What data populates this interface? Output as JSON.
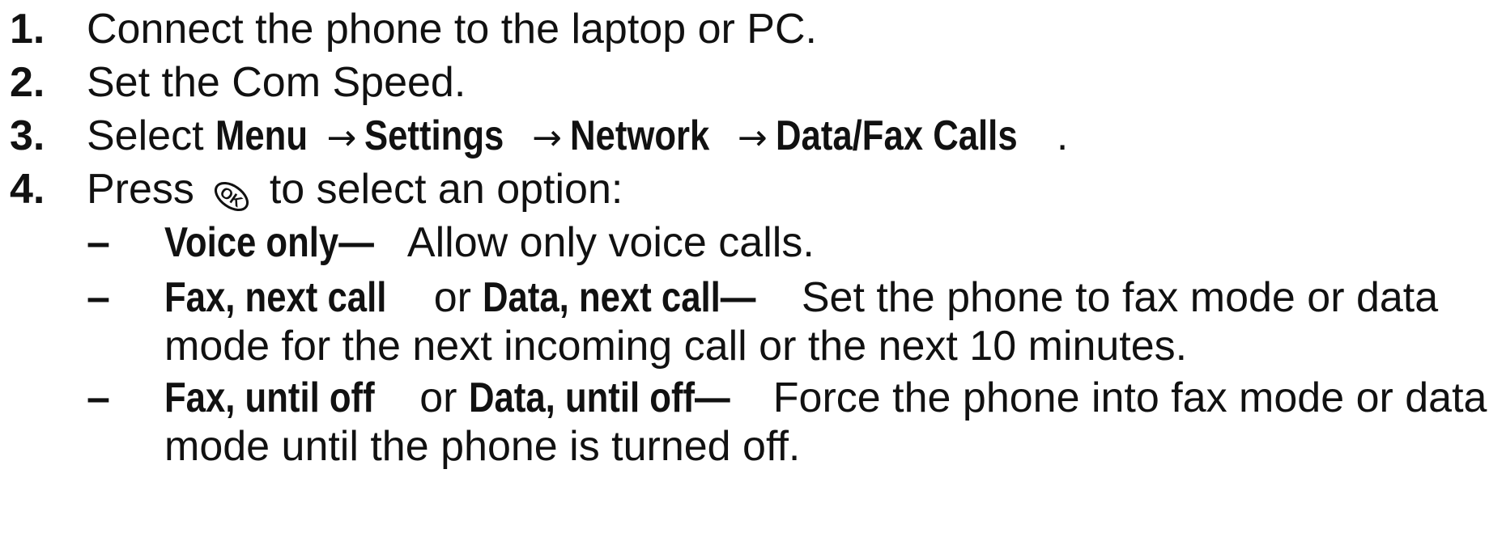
{
  "steps": [
    {
      "number": "1.",
      "text": "Connect the phone to the laptop or PC."
    },
    {
      "number": "2.",
      "text": "Set the Com Speed."
    },
    {
      "number": "3.",
      "prefix": "Select ",
      "path": [
        "Menu",
        "Settings",
        "Network",
        "Data/Fax Calls"
      ],
      "arrow": "→",
      "suffix": "."
    },
    {
      "number": "4.",
      "prefix": "Press ",
      "key_icon": "ok-key-icon",
      "key_label": "OK",
      "suffix": " to select an option:"
    }
  ],
  "options": [
    {
      "dash": "–",
      "term": "Voice only—",
      "desc": "Allow only voice calls."
    },
    {
      "dash": "–",
      "term_a": "Fax, next call",
      "or": " or ",
      "term_b": "Data, next call—",
      "desc": "Set the phone to fax mode or data mode for the next incoming call or the next 10 minutes."
    },
    {
      "dash": "–",
      "term_a": "Fax, until off",
      "or": " or ",
      "term_b": "Data, until off—",
      "desc": "Force the phone into fax mode or data mode until the phone is turned off."
    }
  ],
  "colors": {
    "text": "#111111",
    "background": "#ffffff"
  }
}
